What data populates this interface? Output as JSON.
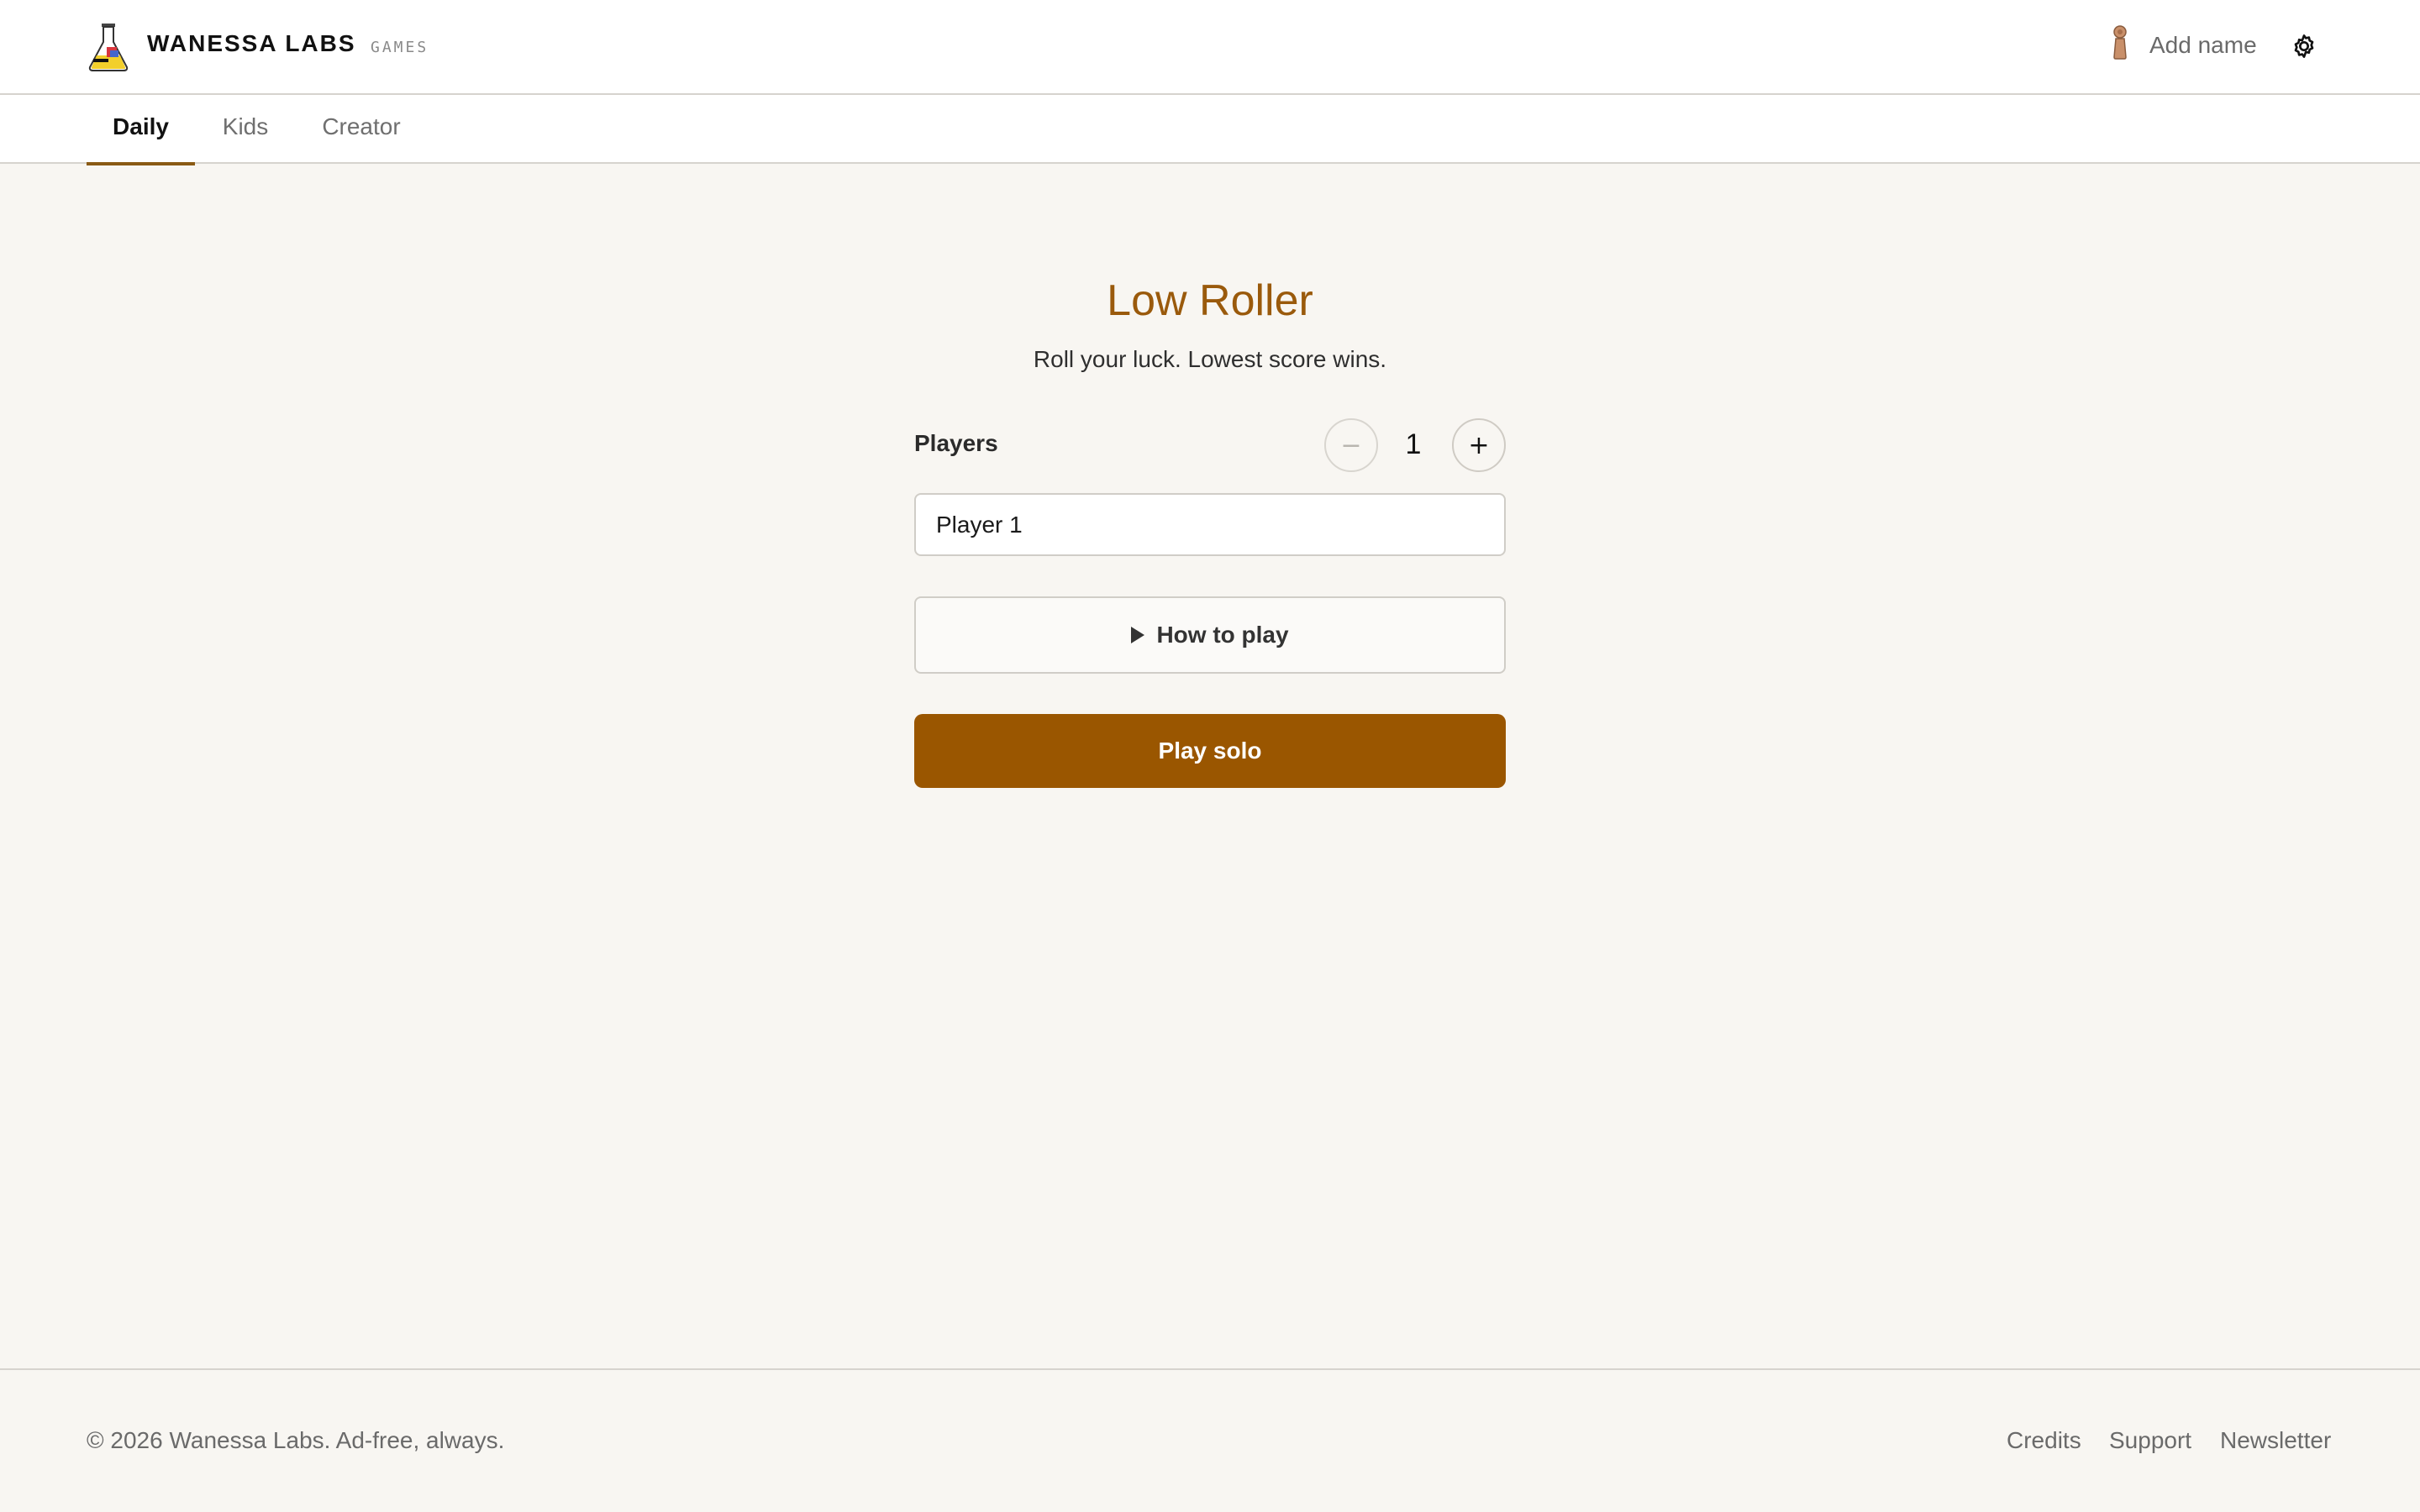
{
  "header": {
    "brand": "WANESSA LABS",
    "brand_sub": "GAMES",
    "user_label": "Add name",
    "icons": {
      "logo": "flask-logo",
      "user": "pawn-icon",
      "settings": "gear-icon"
    }
  },
  "tabs": [
    {
      "label": "Daily",
      "active": true
    },
    {
      "label": "Kids",
      "active": false
    },
    {
      "label": "Creator",
      "active": false
    }
  ],
  "game": {
    "title": "Low Roller",
    "subtitle": "Roll your luck. Lowest score wins.",
    "players_label": "Players",
    "players_count": "1",
    "decrement": "−",
    "increment": "+",
    "player_name_value": "Player 1",
    "how_to_play": "How to play",
    "play_button": "Play solo"
  },
  "footer": {
    "copyright": "© 2026 Wanessa Labs. Ad-free, always.",
    "links": [
      "Credits",
      "Support",
      "Newsletter"
    ]
  },
  "colors": {
    "accent": "#9a5600",
    "title": "#9a5a0c",
    "background": "#f8f6f2"
  }
}
